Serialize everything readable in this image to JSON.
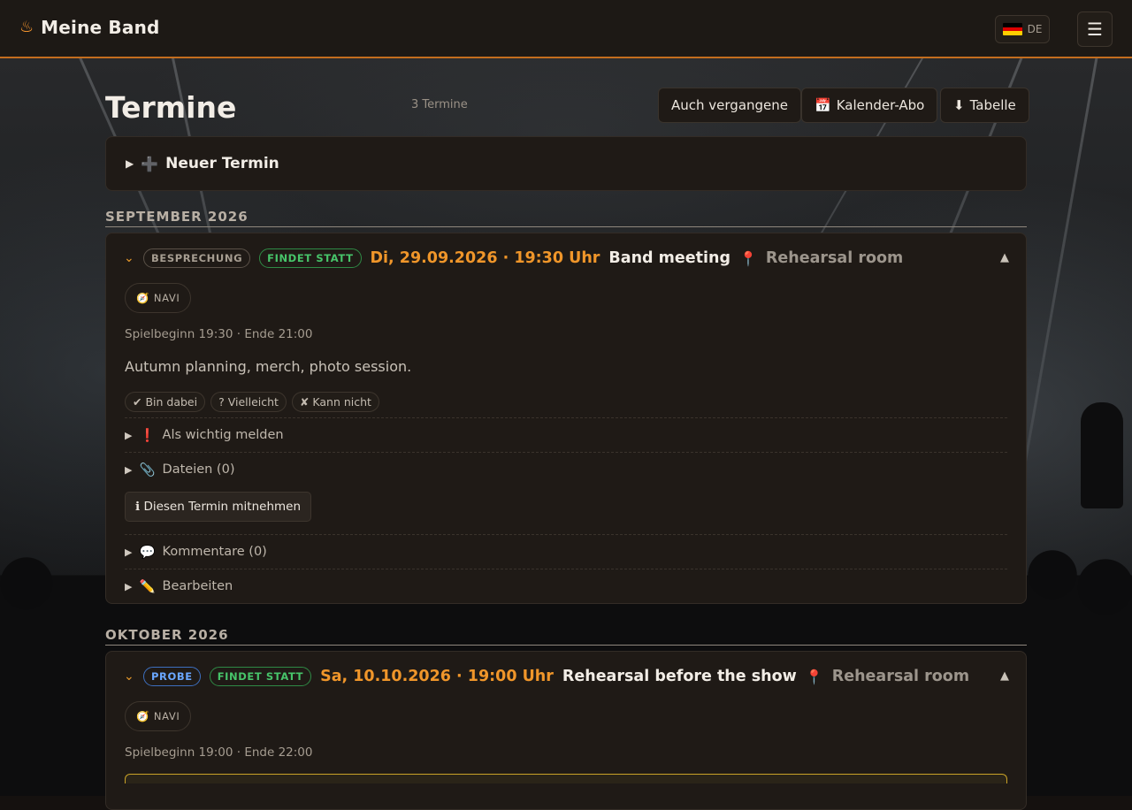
{
  "topbar": {
    "app_name": "Meine Band",
    "brand_icon": "flame-icon",
    "lang_code": "DE",
    "flag_colors": [
      "#000000",
      "#dd0000",
      "#ffce00"
    ],
    "menu_icon": "hamburger-icon"
  },
  "colors": {
    "accent": "#f0962a",
    "topbar_border": "#c36d1e",
    "status_green": "#47c46a",
    "type_blue": "#6aa7ff"
  },
  "page": {
    "title": "Termine",
    "count": "3 Termine",
    "buttons": {
      "past": "Auch vergangene",
      "calendar": "Kalender-Abo",
      "table": "Tabelle"
    },
    "new_event": "Neuer Termin"
  },
  "months": [
    {
      "label": "SEPTEMBER 2026",
      "events": [
        {
          "type": "BESPRECHUNG",
          "status": "FINDET STATT",
          "datetime": "Di, 29.09.2026 · 19:30 Uhr",
          "title": "Band meeting",
          "location": "Rehearsal room",
          "navi": "NAVI",
          "times": "Spielbeginn 19:30 · Ende 21:00",
          "description": "Autumn planning, merch, photo session.",
          "rsvp": {
            "yes": "✔ Bin dabei",
            "maybe": "? Vielleicht",
            "no": "✘ Kann nicht"
          },
          "important": "Als wichtig melden",
          "files": "Dateien (0)",
          "take": "Diesen Termin mitnehmen",
          "comments": "Kommentare (0)",
          "edit": "Bearbeiten"
        }
      ]
    },
    {
      "label": "OKTOBER 2026",
      "events": [
        {
          "type": "PROBE",
          "status": "FINDET STATT",
          "datetime": "Sa, 10.10.2026 · 19:00 Uhr",
          "title": "Rehearsal before the show",
          "location": "Rehearsal room",
          "navi": "NAVI",
          "times": "Spielbeginn 19:00 · Ende 22:00"
        }
      ]
    }
  ]
}
